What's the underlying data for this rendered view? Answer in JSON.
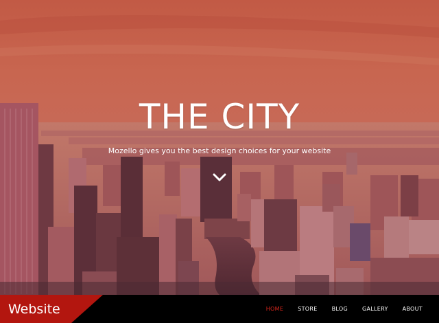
{
  "hero": {
    "title": "THE CITY",
    "subtitle": "Mozello gives you the best design choices for your website",
    "overlay_color": "#b8483f"
  },
  "header": {
    "brand": "Website",
    "brand_color": "#b3160f"
  },
  "nav": {
    "items": [
      {
        "label": "HOME",
        "active": true
      },
      {
        "label": "STORE",
        "active": false
      },
      {
        "label": "BLOG",
        "active": false
      },
      {
        "label": "GALLERY",
        "active": false
      },
      {
        "label": "ABOUT",
        "active": false
      }
    ],
    "active_color": "#d9261c"
  },
  "icons": {
    "scroll": "chevron-down-icon"
  }
}
